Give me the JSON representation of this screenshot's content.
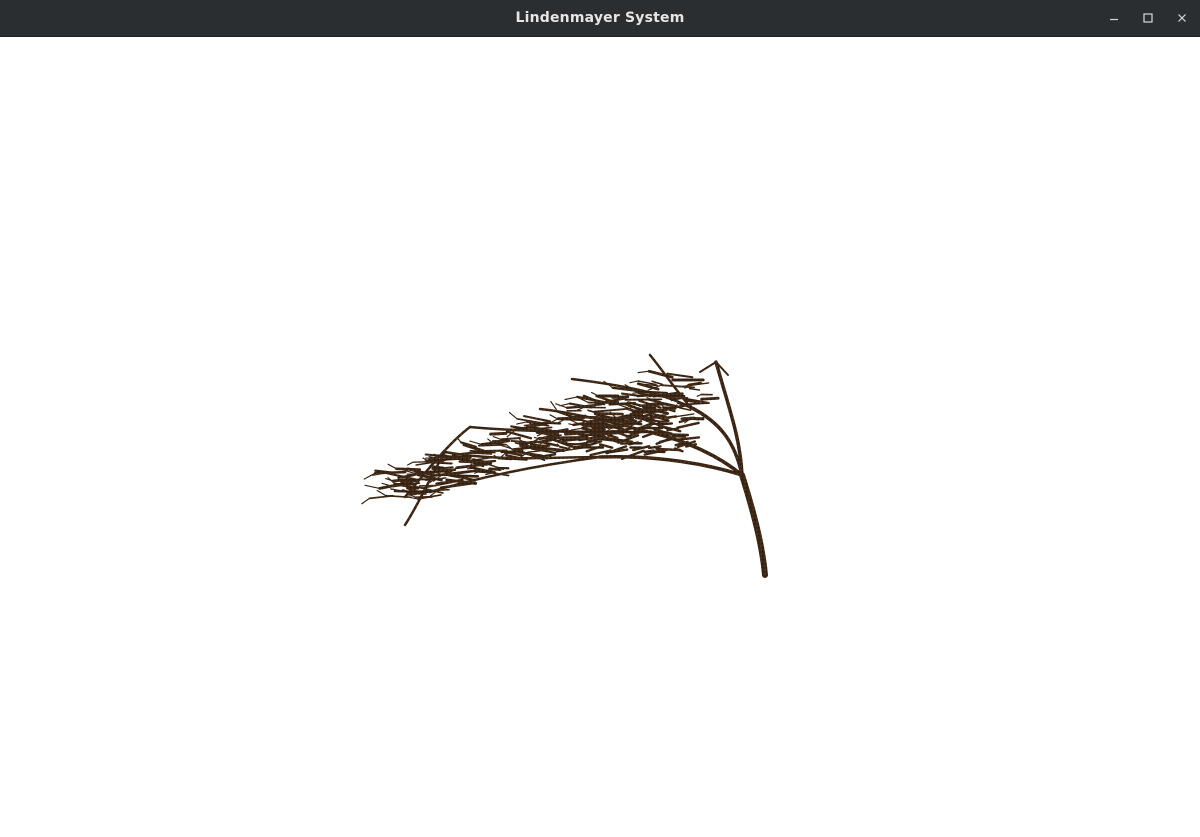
{
  "window": {
    "title": "Lindenmayer System",
    "controls": {
      "minimize_icon": "minimize-icon",
      "maximize_icon": "maximize-icon",
      "close_icon": "close-icon"
    }
  },
  "scene": {
    "background": "#ffffff",
    "branch_color": "#3a2616",
    "branch_highlight": "#5a3c22"
  }
}
